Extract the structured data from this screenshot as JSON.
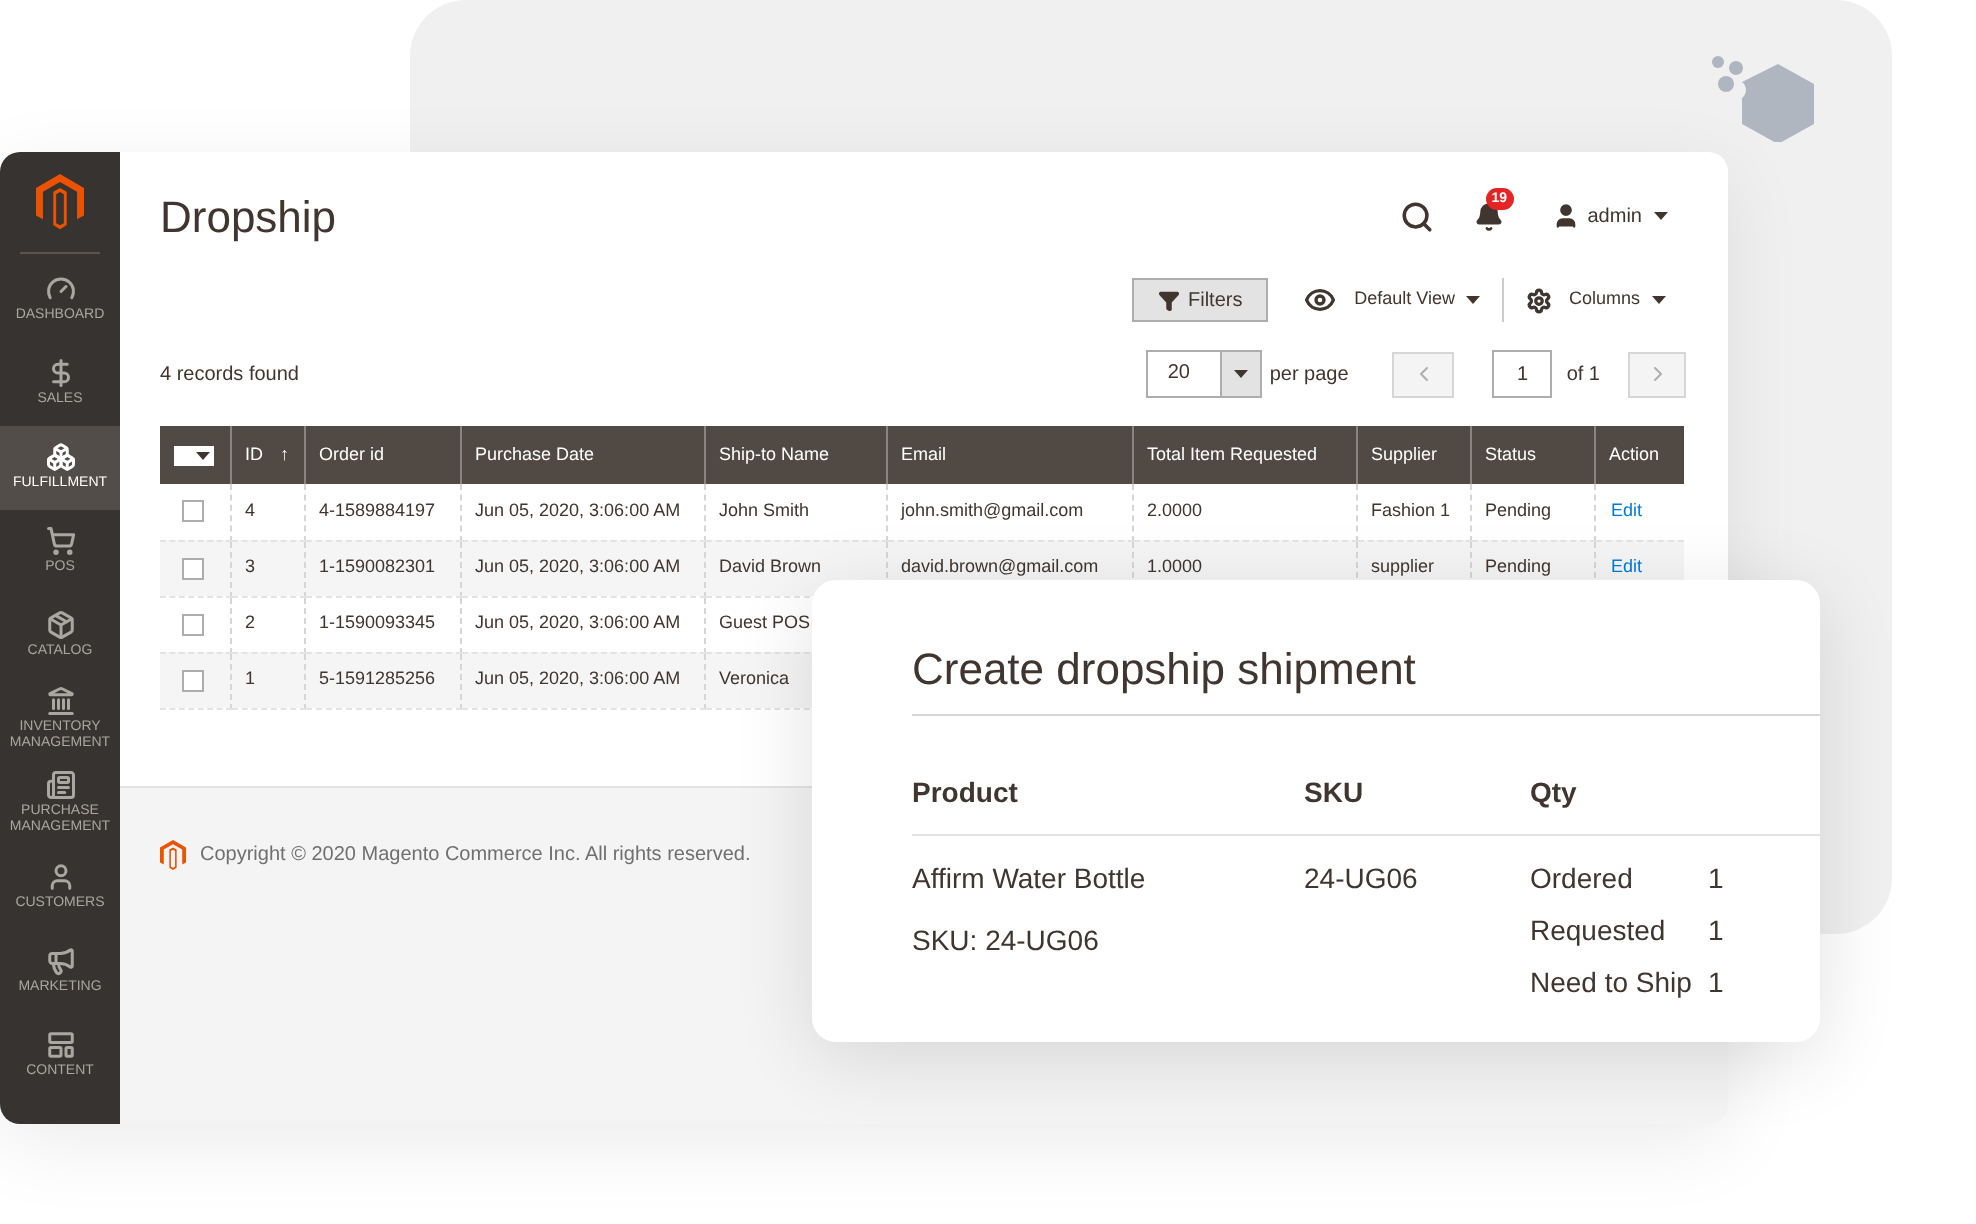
{
  "sidebar": {
    "items": [
      {
        "label": "DASHBOARD",
        "selected": false
      },
      {
        "label": "SALES",
        "selected": false
      },
      {
        "label": "FULFILLMENT",
        "selected": true
      },
      {
        "label": "POS",
        "selected": false
      },
      {
        "label": "CATALOG",
        "selected": false
      },
      {
        "label": "INVENTORY MANAGEMENT",
        "selected": false
      },
      {
        "label": "PURCHASE MANAGEMENT",
        "selected": false
      },
      {
        "label": "CUSTOMERS",
        "selected": false
      },
      {
        "label": "MARKETING",
        "selected": false
      },
      {
        "label": "CONTENT",
        "selected": false
      }
    ]
  },
  "header": {
    "title": "Dropship",
    "notifications_badge": "19",
    "user": "admin"
  },
  "toolbar": {
    "filters": "Filters",
    "view": "Default View",
    "columns": "Columns"
  },
  "records": "4 records found",
  "pagination": {
    "per_page_value": "20",
    "per_page_label": "per page",
    "page": "1",
    "of": "of 1"
  },
  "table": {
    "mass_select": {
      "checked": false
    },
    "sort_indicator": "↑",
    "columns": [
      "ID",
      "Order id",
      "Purchase Date",
      "Ship-to Name",
      "Email",
      "Total Item Requested",
      "Supplier",
      "Status",
      "Action"
    ],
    "rows": [
      {
        "checked": false,
        "cells": [
          "4",
          "4-1589884197",
          "Jun 05, 2020, 3:06:00 AM",
          "John Smith",
          "john.smith@gmail.com",
          "2.0000",
          "Fashion 1",
          "Pending",
          "Edit"
        ]
      },
      {
        "checked": false,
        "cells": [
          "3",
          "1-1590082301",
          "Jun 05, 2020, 3:06:00 AM",
          "David Brown",
          "david.brown@gmail.com",
          "1.0000",
          "supplier",
          "Pending",
          "Edit"
        ]
      },
      {
        "checked": false,
        "cells": [
          "2",
          "1-1590093345",
          "Jun 05, 2020, 3:06:00 AM",
          "Guest POS"
        ]
      },
      {
        "checked": false,
        "cells": [
          "1",
          "5-1591285256",
          "Jun 05, 2020, 3:06:00 AM",
          "Veronica"
        ]
      }
    ]
  },
  "footer": "Copyright © 2020 Magento Commerce Inc. All rights reserved.",
  "shipment_card": {
    "title": "Create dropship shipment",
    "columns": [
      "Product",
      "SKU",
      "Qty"
    ],
    "product": "Affirm Water Bottle",
    "product_sku": "SKU: 24-UG06",
    "sku": "24-UG06",
    "qty": [
      {
        "label": "Ordered",
        "value": "1"
      },
      {
        "label": "Requested",
        "value": "1"
      },
      {
        "label": "Need to Ship",
        "value": "1"
      }
    ]
  }
}
